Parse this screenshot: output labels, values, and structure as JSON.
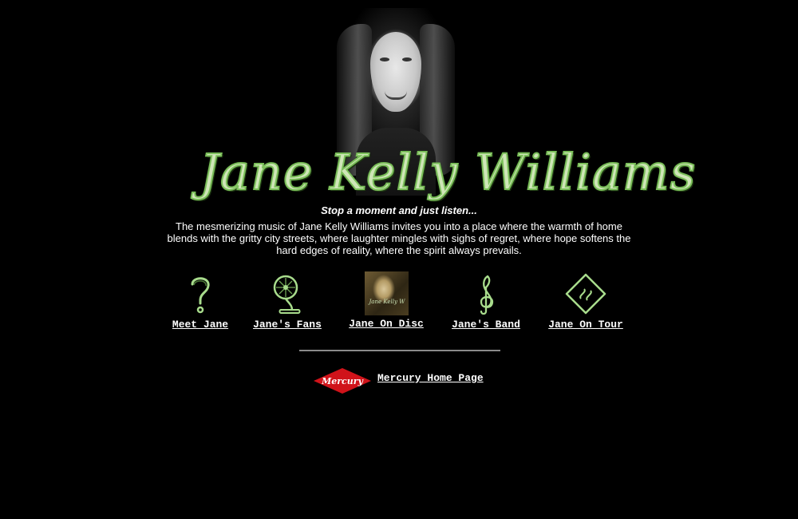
{
  "header": {
    "title_logo_text": "Jane Kelly Williams"
  },
  "intro": {
    "tagline": "Stop a moment and just listen...",
    "body": "The mesmerizing music of Jane Kelly Williams invites you into a place where the warmth of home blends with the gritty city streets, where laughter mingles with sighs of regret, where hope softens the hard edges of reality, where the spirit always prevails."
  },
  "nav": {
    "items": [
      {
        "label": "Meet Jane",
        "icon": "question-mark-icon"
      },
      {
        "label": "Jane's Fans",
        "icon": "fan-icon"
      },
      {
        "label": "Jane On Disc",
        "icon": "cd-cover-thumbnail"
      },
      {
        "label": "Jane's Band",
        "icon": "treble-clef-icon"
      },
      {
        "label": "Jane On Tour",
        "icon": "road-sign-icon"
      }
    ]
  },
  "footer": {
    "logo_text": "Mercury",
    "link_label": "Mercury Home Page"
  },
  "colors": {
    "background": "#000000",
    "text": "#ffffff",
    "accent_green": "#a8dc8c",
    "mercury_red": "#d0131a"
  }
}
